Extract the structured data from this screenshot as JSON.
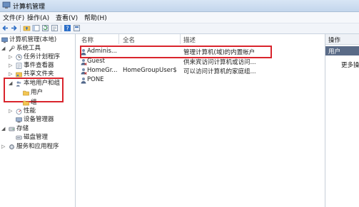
{
  "window": {
    "title": "计算机管理"
  },
  "menu": [
    "文件(F)",
    "操作(A)",
    "查看(V)",
    "帮助(H)"
  ],
  "toolbar": {
    "icons": [
      "back-arrow-icon",
      "forward-arrow-icon",
      "up-folder-icon",
      "show-tree-icon",
      "refresh-icon",
      "export-icon",
      "help-icon",
      "console-icon"
    ]
  },
  "tree": {
    "root": "计算机管理(本地)",
    "system_tools": "系统工具",
    "task_scheduler": "任务计划程序",
    "event_viewer": "事件查看器",
    "shared_folders": "共享文件夹",
    "local_users_groups": "本地用户和组",
    "users": "用户",
    "groups": "组",
    "performance": "性能",
    "device_manager": "设备管理器",
    "storage": "存储",
    "disk_management": "磁盘管理",
    "services_apps": "服务和应用程序"
  },
  "list": {
    "columns": [
      "名称",
      "全名",
      "描述"
    ],
    "rows": [
      {
        "name": "Adminis...",
        "fullname": "",
        "desc": "管理计算机(域)的内置帐户"
      },
      {
        "name": "Guest",
        "fullname": "",
        "desc": "供来宾访问计算机或访问..."
      },
      {
        "name": "HomeGr...",
        "fullname": "HomeGroupUser$",
        "desc": "可以访问计算机的家庭组..."
      },
      {
        "name": "PONE",
        "fullname": "",
        "desc": ""
      }
    ]
  },
  "actions": {
    "header": "操作",
    "section": "用户",
    "more": "更多操"
  },
  "colors": {
    "highlight": "#d9242c",
    "action_bar": "#5a6b87"
  }
}
